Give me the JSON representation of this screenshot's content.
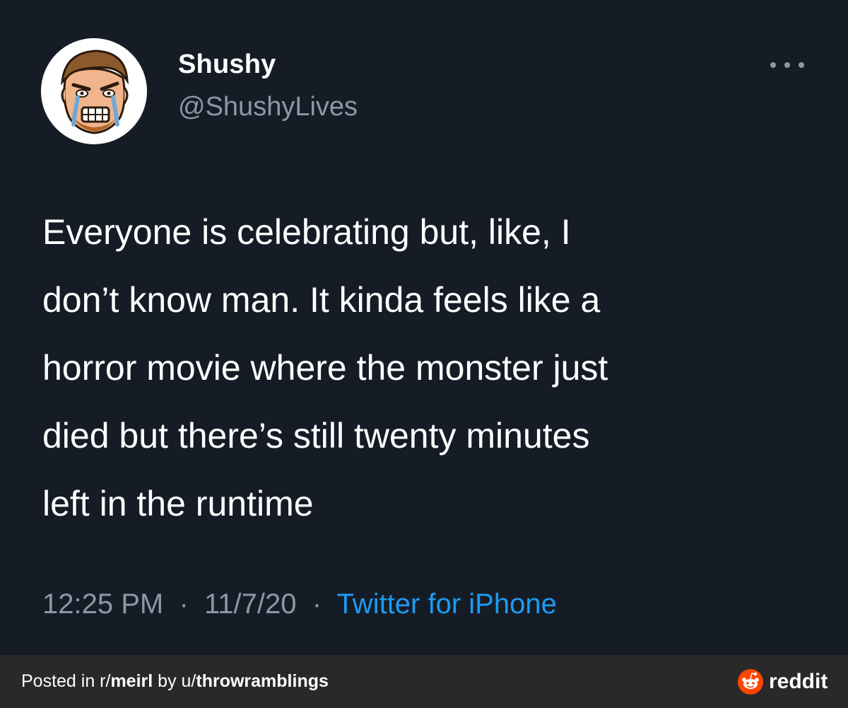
{
  "tweet": {
    "display_name": "Shushy",
    "handle": "@ShushyLives",
    "text": "Everyone is celebrating but, like, I\ndon’t know man. It kinda feels like a\nhorror movie where the monster just\ndied but there’s still twenty minutes\nleft in the runtime",
    "time": "12:25 PM",
    "date": "11/7/20",
    "separator": "·",
    "source": "Twitter for iPhone"
  },
  "footer": {
    "posted_in_label": "Posted in r/",
    "subreddit": "meirl",
    "by_label": " by u/",
    "username": "throwramblings",
    "brand": "reddit"
  },
  "colors": {
    "background": "#151c26",
    "footer_background": "#292929",
    "secondary_text": "#8b98a5",
    "link": "#1d9bf0",
    "reddit_orange": "#ff4500"
  },
  "icons": {
    "more": "more-options-icon",
    "reddit": "reddit-logo-icon",
    "avatar": "avatar"
  }
}
